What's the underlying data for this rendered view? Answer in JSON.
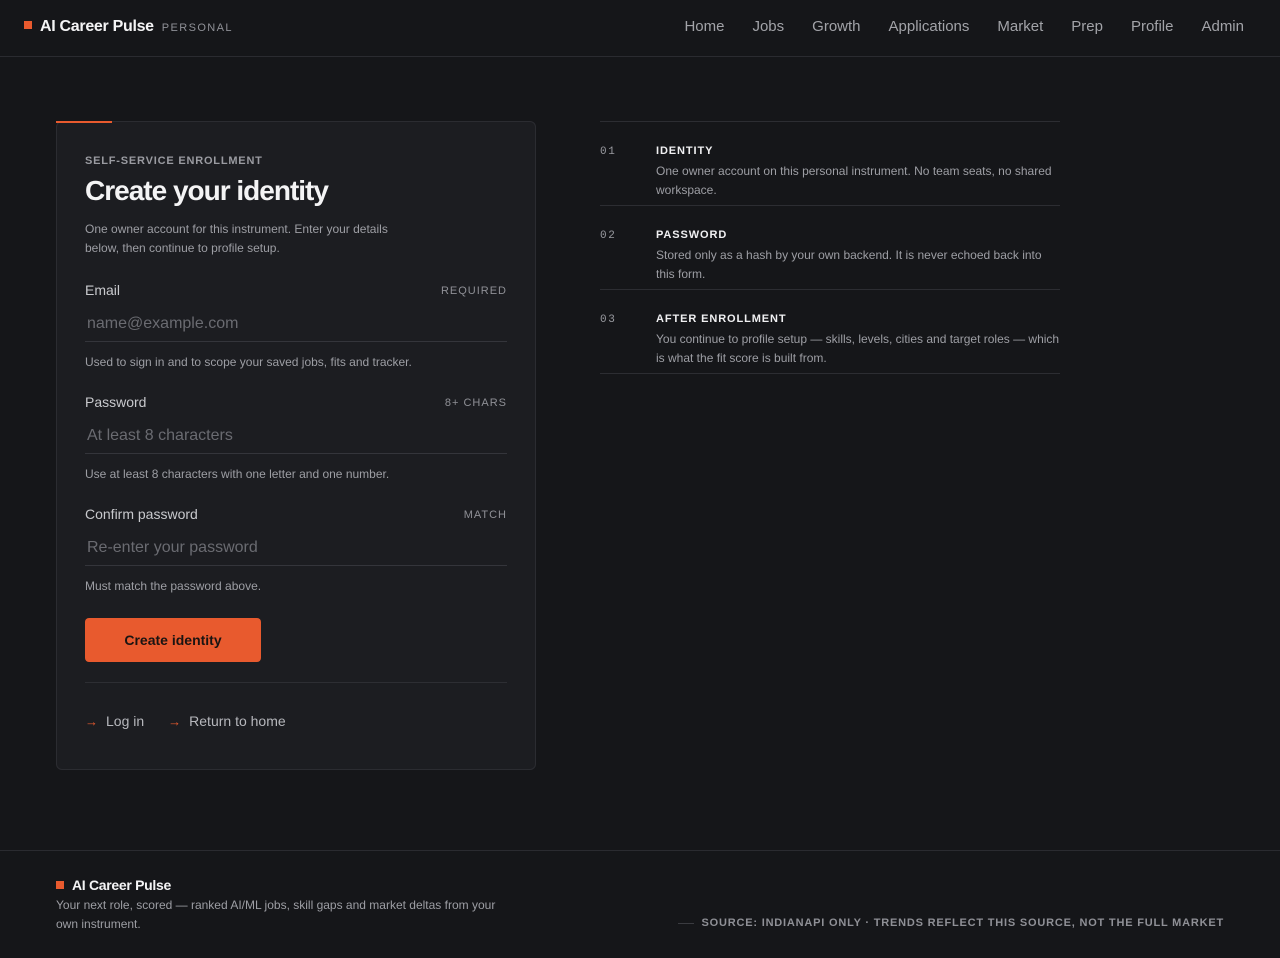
{
  "header": {
    "brand_name": "AI Career Pulse",
    "brand_tag": "PERSONAL",
    "nav": [
      "Home",
      "Jobs",
      "Growth",
      "Applications",
      "Market",
      "Prep",
      "Profile",
      "Admin"
    ]
  },
  "card": {
    "eyebrow": "SELF-SERVICE ENROLLMENT",
    "title": "Create your identity",
    "intro": "One owner account for this instrument. Enter your details below, then continue to profile setup.",
    "fields": {
      "email": {
        "label": "Email",
        "tag": "REQUIRED",
        "value": "",
        "placeholder": "name@example.com",
        "help": "Used to sign in and to scope your saved jobs, fits and tracker."
      },
      "password": {
        "label": "Password",
        "tag": "8+ CHARS",
        "value": "",
        "placeholder": "At least 8 characters",
        "help": "Use at least 8 characters with one letter and one number."
      },
      "confirm": {
        "label": "Confirm password",
        "tag": "MATCH",
        "value": "",
        "placeholder": "Re-enter your password",
        "help": "Must match the password above."
      }
    },
    "submit_label": "Create identity",
    "links": {
      "arrow": "→",
      "login": "Log in",
      "home": "Return to home"
    }
  },
  "steps": [
    {
      "num": "01",
      "title": "IDENTITY",
      "desc": "One owner account on this personal instrument. No team seats, no shared workspace."
    },
    {
      "num": "02",
      "title": "PASSWORD",
      "desc": "Stored only as a hash by your own backend. It is never echoed back into this form."
    },
    {
      "num": "03",
      "title": "AFTER ENROLLMENT",
      "desc": "You continue to profile setup — skills, levels, cities and target roles — which is what the fit score is built from."
    }
  ],
  "footer": {
    "brand_name": "AI Career Pulse",
    "tagline": "Your next role, scored — ranked AI/ML jobs, skill gaps and market deltas from your own instrument.",
    "source": "SOURCE: INDIANAPI ONLY · TRENDS REFLECT THIS SOURCE, NOT THE FULL MARKET"
  },
  "colors": {
    "accent": "#e85a2e",
    "background": "#151619",
    "card": "#1c1d21"
  }
}
